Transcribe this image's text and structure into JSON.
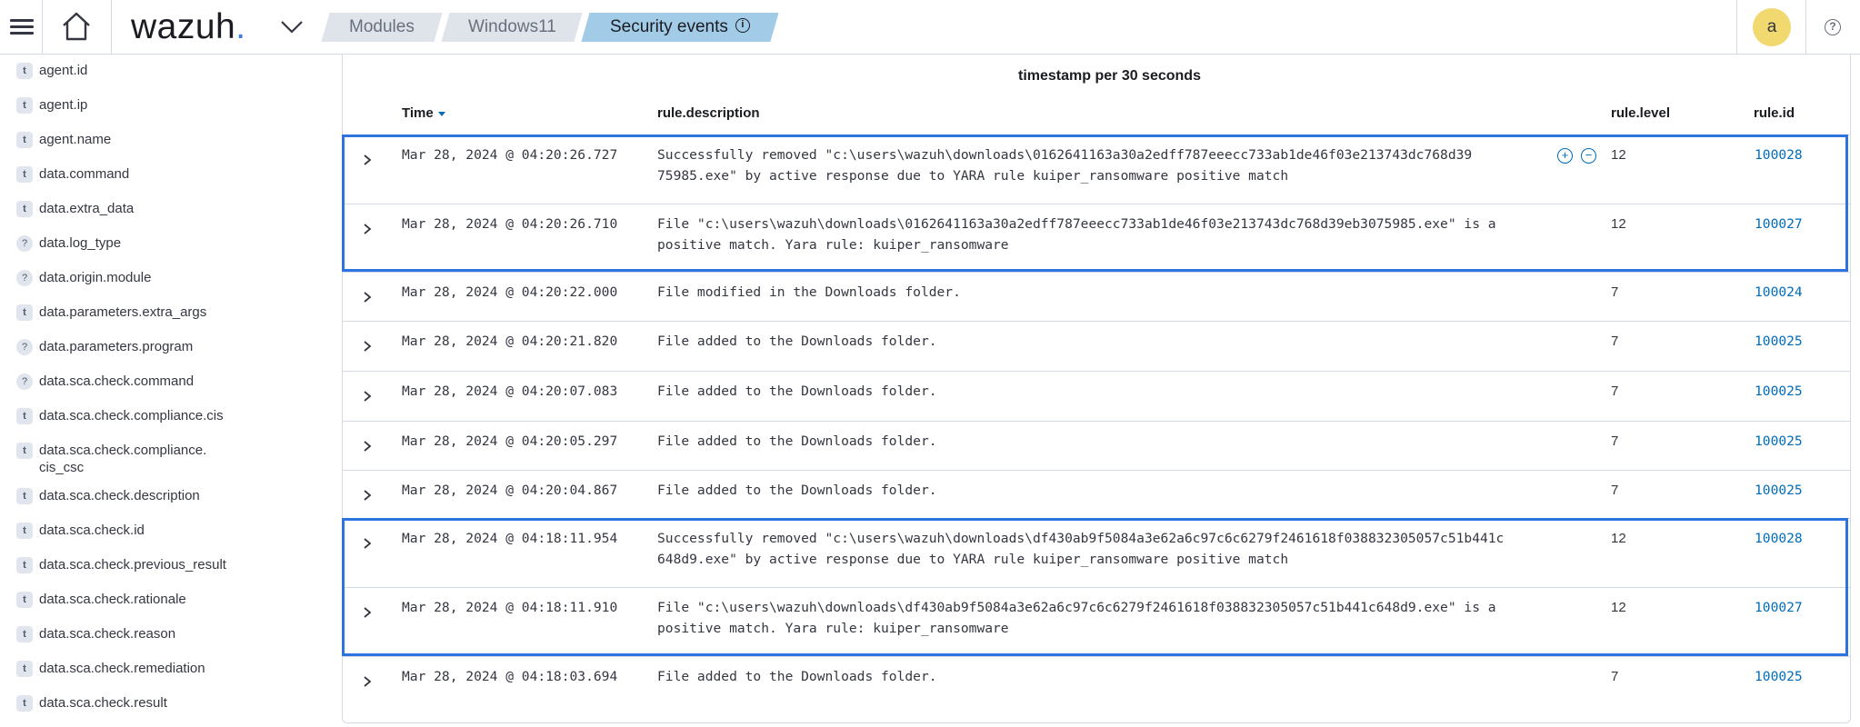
{
  "header": {
    "logo_text": "wazuh",
    "logo_dot": ".",
    "breadcrumbs": [
      "Modules",
      "Windows11",
      "Security events"
    ],
    "info_glyph": "i",
    "avatar_letter": "a",
    "help_glyph": "?"
  },
  "sidebar": {
    "fields": [
      {
        "type": "t",
        "name": "agent.id"
      },
      {
        "type": "t",
        "name": "agent.ip"
      },
      {
        "type": "t",
        "name": "agent.name"
      },
      {
        "type": "t",
        "name": "data.command"
      },
      {
        "type": "t",
        "name": "data.extra_data"
      },
      {
        "type": "?",
        "name": "data.log_type"
      },
      {
        "type": "?",
        "name": "data.origin.module"
      },
      {
        "type": "t",
        "name": "data.parameters.extra_args"
      },
      {
        "type": "?",
        "name": "data.parameters.program"
      },
      {
        "type": "?",
        "name": "data.sca.check.command"
      },
      {
        "type": "t",
        "name": "data.sca.check.compliance.cis"
      },
      {
        "type": "t",
        "name": "data.sca.check.compliance.\ncis_csc"
      },
      {
        "type": "t",
        "name": "data.sca.check.description"
      },
      {
        "type": "t",
        "name": "data.sca.check.id"
      },
      {
        "type": "t",
        "name": "data.sca.check.previous_result"
      },
      {
        "type": "t",
        "name": "data.sca.check.rationale"
      },
      {
        "type": "t",
        "name": "data.sca.check.reason"
      },
      {
        "type": "t",
        "name": "data.sca.check.remediation"
      },
      {
        "type": "t",
        "name": "data.sca.check.result"
      }
    ]
  },
  "table": {
    "chart_title": "timestamp per 30 seconds",
    "columns": {
      "time": "Time",
      "description": "rule.description",
      "level": "rule.level",
      "id": "rule.id"
    },
    "filter_in_glyph": "+",
    "filter_out_glyph": "−",
    "rows": [
      {
        "time": "Mar 28, 2024 @ 04:20:26.727",
        "description": "Successfully removed \"c:\\users\\wazuh\\downloads\\0162641163a30a2edff787eeecc733ab1de46f03e213743dc768d39\n75985.exe\" by active response due to YARA rule kuiper_ransomware positive match",
        "level": "12",
        "id": "100028"
      },
      {
        "time": "Mar 28, 2024 @ 04:20:26.710",
        "description": "File \"c:\\users\\wazuh\\downloads\\0162641163a30a2edff787eeecc733ab1de46f03e213743dc768d39eb3075985.exe\" is a\npositive match. Yara rule: kuiper_ransomware",
        "level": "12",
        "id": "100027"
      },
      {
        "time": "Mar 28, 2024 @ 04:20:22.000",
        "description": "File modified in the Downloads folder.",
        "level": "7",
        "id": "100024"
      },
      {
        "time": "Mar 28, 2024 @ 04:20:21.820",
        "description": "File added to the Downloads folder.",
        "level": "7",
        "id": "100025"
      },
      {
        "time": "Mar 28, 2024 @ 04:20:07.083",
        "description": "File added to the Downloads folder.",
        "level": "7",
        "id": "100025"
      },
      {
        "time": "Mar 28, 2024 @ 04:20:05.297",
        "description": "File added to the Downloads folder.",
        "level": "7",
        "id": "100025"
      },
      {
        "time": "Mar 28, 2024 @ 04:20:04.867",
        "description": "File added to the Downloads folder.",
        "level": "7",
        "id": "100025"
      },
      {
        "time": "Mar 28, 2024 @ 04:18:11.954",
        "description": "Successfully removed \"c:\\users\\wazuh\\downloads\\df430ab9f5084a3e62a6c97c6c6279f2461618f038832305057c51b441c\n648d9.exe\" by active response due to YARA rule kuiper_ransomware positive match",
        "level": "12",
        "id": "100028"
      },
      {
        "time": "Mar 28, 2024 @ 04:18:11.910",
        "description": "File \"c:\\users\\wazuh\\downloads\\df430ab9f5084a3e62a6c97c6c6279f2461618f038832305057c51b441c648d9.exe\" is a\npositive match. Yara rule: kuiper_ransomware",
        "level": "12",
        "id": "100027"
      },
      {
        "time": "Mar 28, 2024 @ 04:18:03.694",
        "description": "File added to the Downloads folder.",
        "level": "7",
        "id": "100025"
      }
    ]
  },
  "colors": {
    "accent": "#006bb8",
    "highlight_border": "#2d74e0",
    "active_crumb": "#a2cbe8",
    "avatar": "#f1d86f"
  }
}
